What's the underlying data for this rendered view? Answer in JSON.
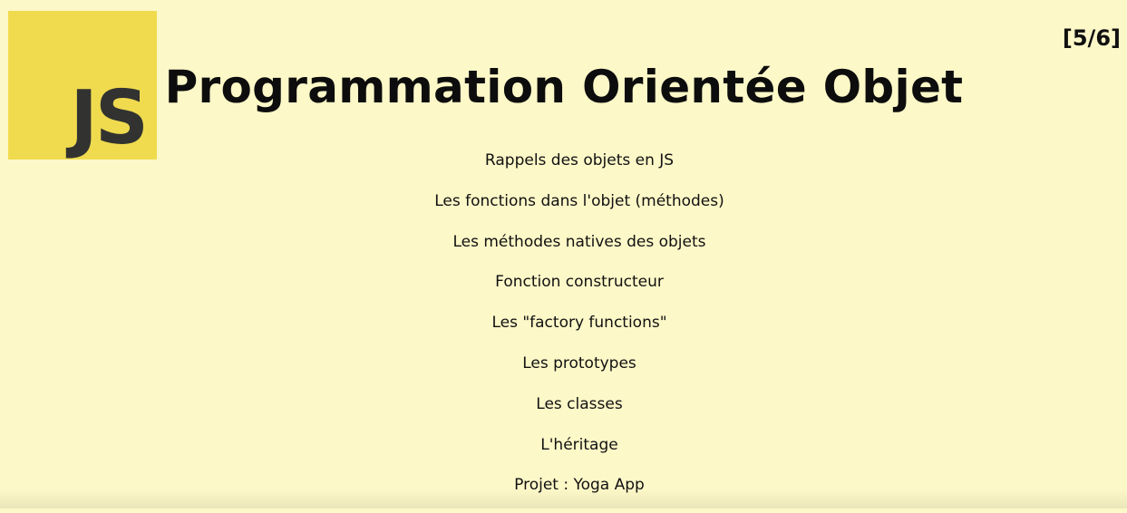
{
  "slide": {
    "logo_text": "JS",
    "counter": "[5/6]",
    "title": "Programmation Orientée Objet",
    "topics": [
      "Rappels des objets en JS",
      "Les fonctions dans l'objet (méthodes)",
      "Les méthodes natives des objets",
      "Fonction constructeur",
      "Les \"factory functions\"",
      "Les prototypes",
      "Les classes",
      "L'héritage",
      "Projet : Yoga App"
    ]
  },
  "colors": {
    "background": "#fdf8c8",
    "logo_background": "#f0db4f",
    "logo_text": "#323330",
    "text": "#111111"
  }
}
